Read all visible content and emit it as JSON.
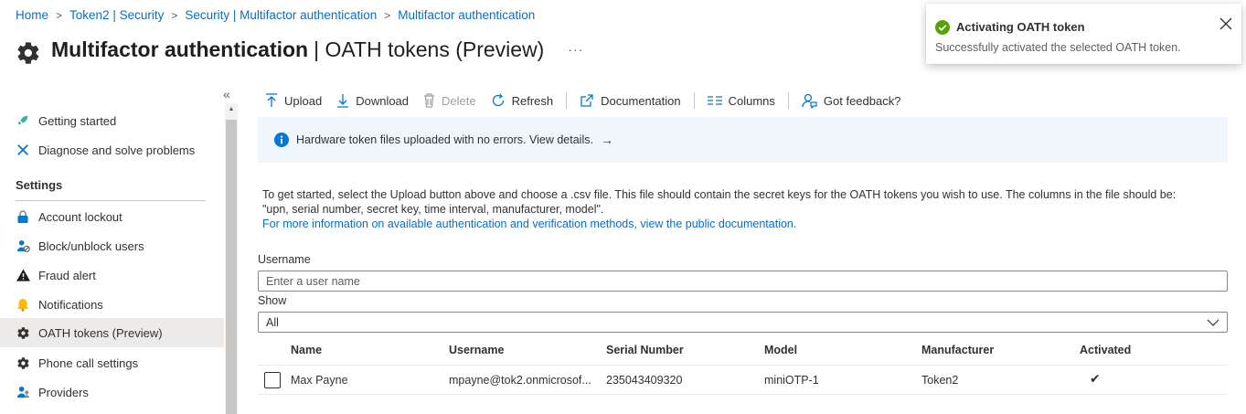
{
  "breadcrumb": {
    "items": [
      "Home",
      "Token2 | Security",
      "Security | Multifactor authentication",
      "Multifactor authentication"
    ],
    "separator": ">"
  },
  "header": {
    "title_main": "Multifactor authentication",
    "title_sub": "| OATH tokens (Preview)",
    "more": "···"
  },
  "sidebar": {
    "collapse_glyph": "«",
    "items": [
      {
        "label": "Getting started",
        "icon": "rocket-icon"
      },
      {
        "label": "Diagnose and solve problems",
        "icon": "wrench-icon"
      }
    ],
    "section_title": "Settings",
    "settings_items": [
      {
        "label": "Account lockout",
        "icon": "lock-icon"
      },
      {
        "label": "Block/unblock users",
        "icon": "block-user-icon"
      },
      {
        "label": "Fraud alert",
        "icon": "warning-icon"
      },
      {
        "label": "Notifications",
        "icon": "bell-icon"
      },
      {
        "label": "OATH tokens (Preview)",
        "icon": "gear-icon",
        "active": true
      },
      {
        "label": "Phone call settings",
        "icon": "gear-icon"
      },
      {
        "label": "Providers",
        "icon": "users-icon"
      }
    ]
  },
  "toolbar": {
    "upload": "Upload",
    "download": "Download",
    "delete": "Delete",
    "refresh": "Refresh",
    "documentation": "Documentation",
    "columns": "Columns",
    "feedback": "Got feedback?"
  },
  "info_bar": {
    "text": "Hardware token files uploaded with no errors. View details.",
    "arrow": "→"
  },
  "description": {
    "line1": "To get started, select the Upload button above and choose a .csv file. This file should contain the secret keys for the OATH tokens you wish to use. The columns in the file should be:",
    "line2": "\"upn, serial number, secret key, time interval, manufacturer, model\".",
    "link": "For more information on available authentication and verification methods, view the public documentation."
  },
  "filters": {
    "username_label": "Username",
    "username_placeholder": "Enter a user name",
    "username_value": "",
    "show_label": "Show",
    "show_value": "All"
  },
  "table": {
    "columns": [
      "Name",
      "Username",
      "Serial Number",
      "Model",
      "Manufacturer",
      "Activated"
    ],
    "rows": [
      {
        "name": "Max Payne",
        "username": "mpayne@tok2.onmicrosof...",
        "serial": "235043409320",
        "model": "miniOTP-1",
        "manufacturer": "Token2",
        "activated": "✔"
      }
    ]
  },
  "toast": {
    "title": "Activating OATH token",
    "message": "Successfully activated the selected OATH token."
  },
  "colors": {
    "link": "#0f6cbd",
    "info_bg": "#eff6fc",
    "success": "#107c10",
    "active_nav": "#edebe9"
  }
}
